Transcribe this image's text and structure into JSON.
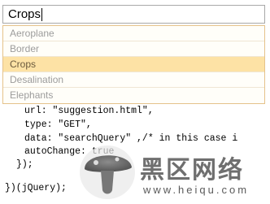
{
  "search": {
    "value": "Crops"
  },
  "dropdown": {
    "items": [
      {
        "label": "Aeroplane",
        "selected": false
      },
      {
        "label": "Border",
        "selected": false
      },
      {
        "label": "Crops",
        "selected": true
      },
      {
        "label": "Desalination",
        "selected": false
      },
      {
        "label": "Elephants",
        "selected": false
      }
    ],
    "colors": {
      "selected_bg": "#fde2a5",
      "border": "#e5c28a",
      "item_text": "#9c9c9c"
    }
  },
  "code": {
    "lines": [
      "url: \"suggestion.html\",",
      "type: \"GET\",",
      "data: \"searchQuery\" ,/* in this case i",
      "autoChange: true",
      "});",
      "})(jQuery);"
    ]
  },
  "watermark": {
    "title": "黑区网络",
    "url": "www.heiqu.com",
    "icon": "mushroom-logo-icon"
  }
}
